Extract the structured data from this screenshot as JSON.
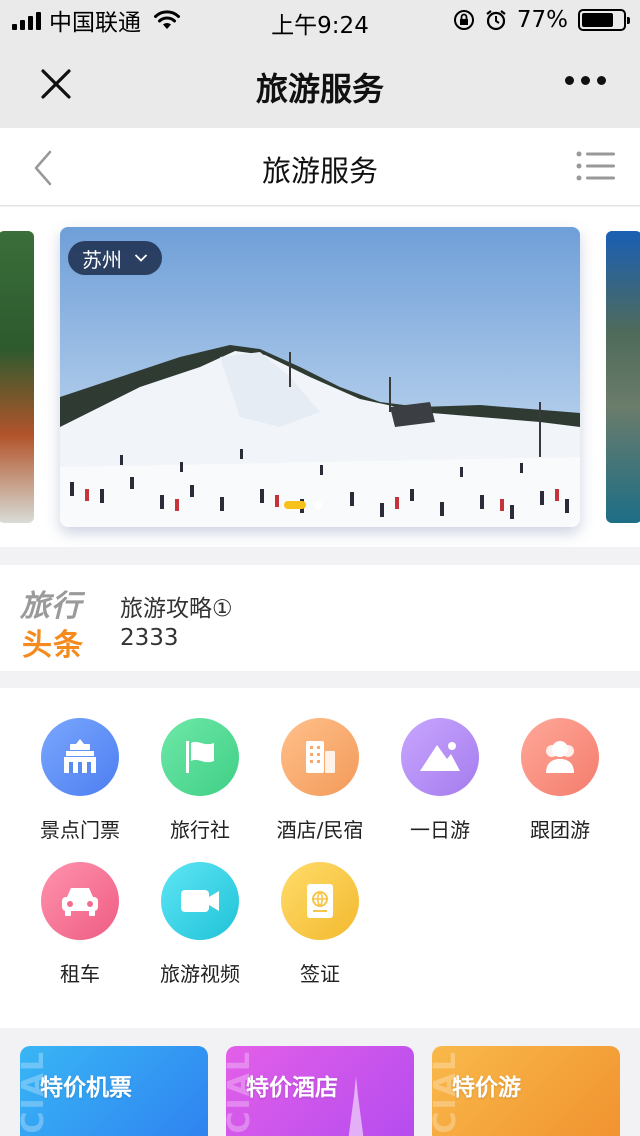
{
  "status_bar": {
    "carrier": "中国联通",
    "time": "上午9:24",
    "battery": "77%",
    "battery_level": 0.77
  },
  "wechat_header": {
    "title": "旅游服务",
    "close_icon": "close-icon",
    "more_icon": "more-dots-icon"
  },
  "nav_bar": {
    "title": "旅游服务",
    "back_icon": "chevron-left-icon",
    "menu_icon": "list-menu-icon"
  },
  "carousel": {
    "city": "苏州",
    "active_slide": 1,
    "slide_count": 2
  },
  "headline": {
    "logo_line1": "旅行",
    "logo_line2": "头条",
    "title": "旅游攻略①",
    "count": "2333"
  },
  "services": [
    {
      "label": "景点门票",
      "icon": "temple-icon",
      "color": "#5a8cf0"
    },
    {
      "label": "旅行社",
      "icon": "flag-icon",
      "color": "#4fd58f"
    },
    {
      "label": "酒店/民宿",
      "icon": "building-icon",
      "color": "#f7a86a"
    },
    {
      "label": "一日游",
      "icon": "mountain-icon",
      "color": "#b58ef0"
    },
    {
      "label": "跟团游",
      "icon": "group-icon",
      "color": "#f88f7e"
    },
    {
      "label": "租车",
      "icon": "car-icon",
      "color": "#f56c8c"
    },
    {
      "label": "旅游视频",
      "icon": "video-camera-icon",
      "color": "#2bd1e6"
    },
    {
      "label": "签证",
      "icon": "passport-icon",
      "color": "#f6c64a"
    }
  ],
  "promos": [
    {
      "label": "特价机票",
      "decor": "CIAL",
      "color": "#3aa4f4"
    },
    {
      "label": "特价酒店",
      "decor": "CIAL",
      "color": "#d25ae8"
    },
    {
      "label": "特价游",
      "decor": "CIAL",
      "color": "#f6a43a"
    }
  ]
}
